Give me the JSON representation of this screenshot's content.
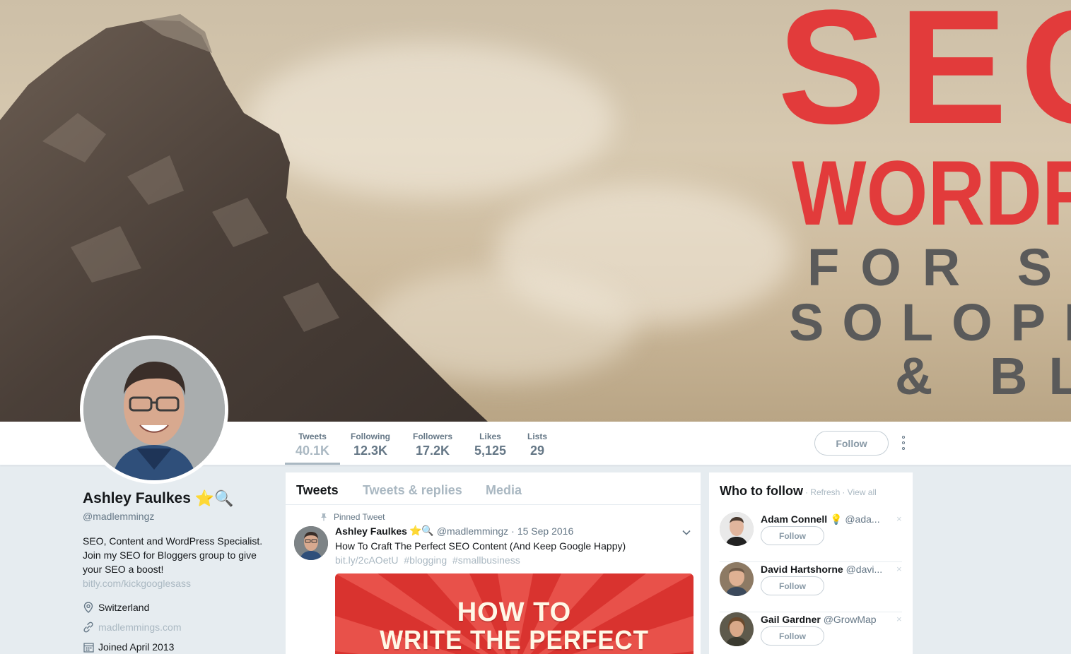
{
  "banner": {
    "line1": "SEO",
    "line2": "WORDP",
    "line3": "FOR SM",
    "line4": "SOLOPR",
    "line5": "& BLO"
  },
  "nav": {
    "stats": [
      {
        "label": "Tweets",
        "value": "40.1K"
      },
      {
        "label": "Following",
        "value": "12.3K"
      },
      {
        "label": "Followers",
        "value": "17.2K"
      },
      {
        "label": "Likes",
        "value": "5,125"
      },
      {
        "label": "Lists",
        "value": "29"
      }
    ],
    "follow_label": "Follow"
  },
  "profile": {
    "name": "Ashley Faulkes",
    "emoji": "⭐🔍",
    "handle": "@madlemmingz",
    "bio": "SEO, Content and WordPress Specialist. Join my SEO for Bloggers group to give your SEO a boost!",
    "bio_link": "bitly.com/kickgooglesass",
    "location": "Switzerland",
    "website": "madlemmings.com",
    "joined": "Joined April 2013"
  },
  "timeline": {
    "tabs": [
      "Tweets",
      "Tweets & replies",
      "Media"
    ],
    "pinned_label": "Pinned Tweet",
    "tweet": {
      "name": "Ashley Faulkes",
      "emoji": "⭐🔍",
      "handle": "@madlemmingz",
      "dot": "·",
      "date": "15 Sep 2016",
      "text": "How To Craft The Perfect SEO Content (And Keep Google Happy)",
      "links": [
        "bit.ly/2cAOetU",
        "#blogging",
        "#smallbusiness"
      ],
      "image_line1": "HOW TO",
      "image_line2": "WRITE THE PERFECT"
    }
  },
  "who_to_follow": {
    "title": "Who to follow",
    "refresh": "· Refresh",
    "view_all": "· View all",
    "follow_label": "Follow",
    "close": "×",
    "suggestions": [
      {
        "name": "Adam Connell",
        "extra": "💡",
        "handle": "@ada..."
      },
      {
        "name": "David Hartshorne",
        "extra": "",
        "handle": "@davi..."
      },
      {
        "name": "Gail Gardner",
        "extra": "",
        "handle": "@GrowMap"
      }
    ]
  },
  "colors": {
    "accent_red": "#e23b3b",
    "muted": "#657786",
    "link_light": "#aab8c2",
    "background": "#e6ecf0"
  }
}
